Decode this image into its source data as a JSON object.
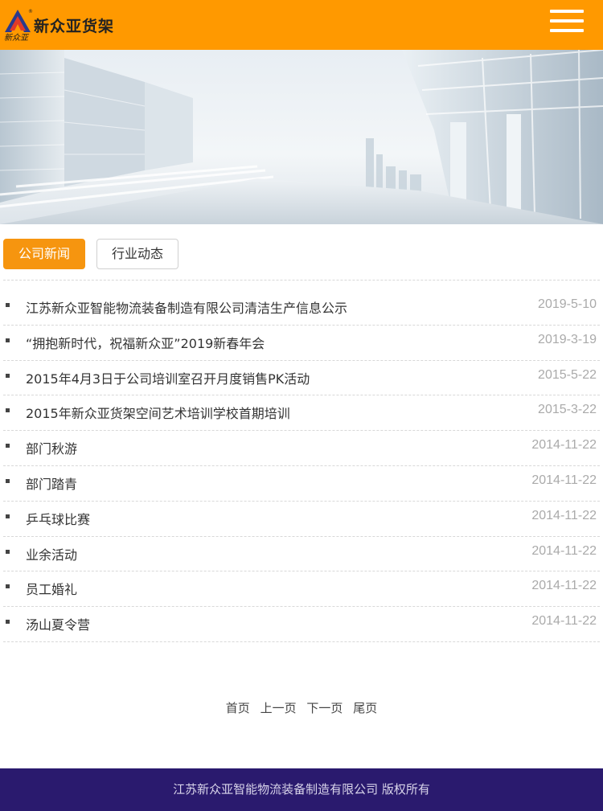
{
  "header": {
    "brand": "新众亚货架",
    "logo_text": "新众亚",
    "registered_mark": "®",
    "background": "#ff9900",
    "menu_icon": "hamburger-menu-icon"
  },
  "tabs": [
    {
      "label": "公司新闻",
      "active": true
    },
    {
      "label": "行业动态",
      "active": false
    }
  ],
  "news": [
    {
      "title": "江苏新众亚智能物流装备制造有限公司清洁生产信息公示",
      "date": "2019-5-10"
    },
    {
      "title": "“拥抱新时代，祝福新众亚”2019新春年会",
      "date": "2019-3-19"
    },
    {
      "title": "2015年4月3日于公司培训室召开月度销售PK活动",
      "date": "2015-5-22"
    },
    {
      "title": "2015年新众亚货架空间艺术培训学校首期培训",
      "date": "2015-3-22"
    },
    {
      "title": "部门秋游",
      "date": "2014-11-22"
    },
    {
      "title": "部门踏青",
      "date": "2014-11-22"
    },
    {
      "title": "乒乓球比赛",
      "date": "2014-11-22"
    },
    {
      "title": "业余活动",
      "date": "2014-11-22"
    },
    {
      "title": "员工婚礼",
      "date": "2014-11-22"
    },
    {
      "title": "汤山夏令营",
      "date": "2014-11-22"
    }
  ],
  "pagination": {
    "first": "首页",
    "prev": "上一页",
    "next": "下一页",
    "last": "尾页"
  },
  "footer": {
    "copyright": "江苏新众亚智能物流装备制造有限公司 版权所有",
    "background": "#2a1a6e"
  },
  "colors": {
    "accent": "#f6950f"
  }
}
